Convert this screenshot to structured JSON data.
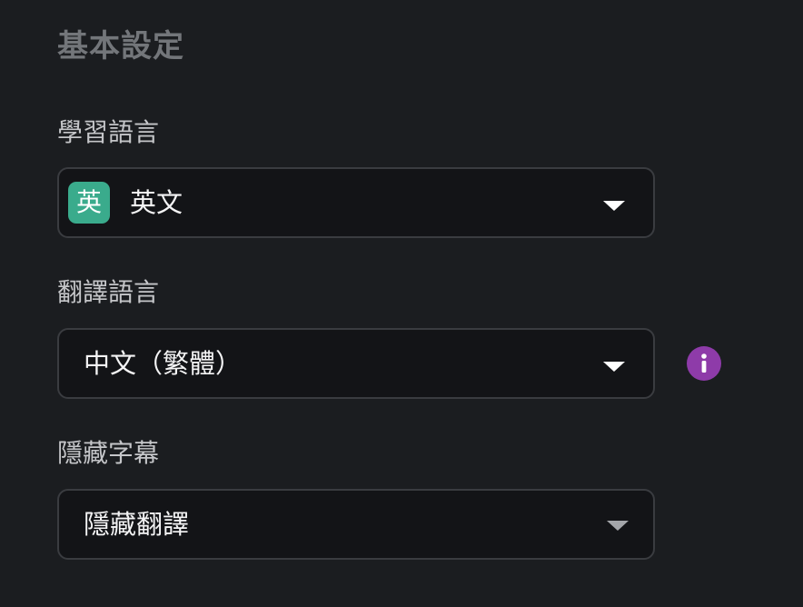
{
  "section_title": "基本設定",
  "fields": [
    {
      "label": "學習語言",
      "value": "英文",
      "badge": "英",
      "icon": "caret-down-icon"
    },
    {
      "label": "翻譯語言",
      "value": "中文（繁體）",
      "icon": "caret-down-icon",
      "info_icon": "info-icon"
    },
    {
      "label": "隱藏字幕",
      "value": "隱藏翻譯",
      "icon": "caret-down-icon"
    }
  ],
  "colors": {
    "bg": "#1b1d20",
    "field-bg": "#131417",
    "field-border": "#3a3c40",
    "title": "#73767a",
    "label": "#c5c6c9",
    "value": "#f4f4f5",
    "badge": "#3aab8c",
    "info": "#8e3ba9",
    "caret": "#ffffff",
    "caret-muted": "#a4a6aa"
  }
}
